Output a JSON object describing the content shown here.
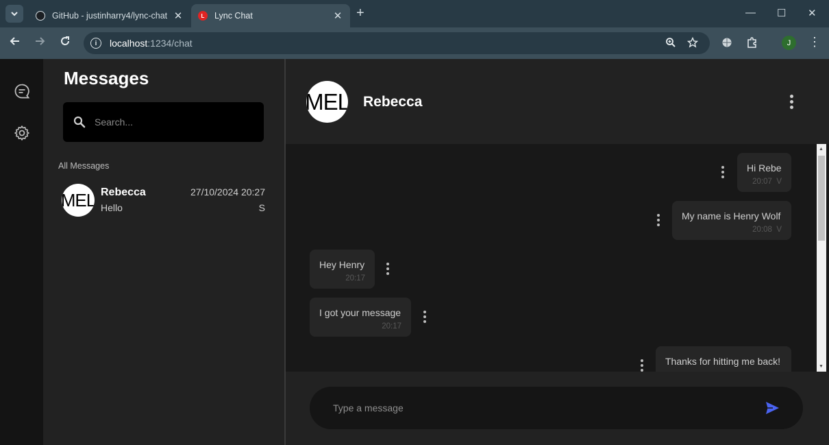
{
  "browser": {
    "tabs": [
      {
        "title": "GitHub - justinharry4/lync-chat",
        "active": false
      },
      {
        "title": "Lync Chat",
        "active": true
      }
    ],
    "url_host": "localhost",
    "url_path": ":1234/chat",
    "profile_initial": "J",
    "favicon_letter": "L"
  },
  "sidebar": {
    "title": "Messages",
    "search_placeholder": "Search...",
    "section_label": "All Messages",
    "conversations": [
      {
        "avatar_text": "MEL",
        "name": "Rebecca",
        "time": "27/10/2024 20:27",
        "last_message": "Hello",
        "status": "S"
      }
    ]
  },
  "chat": {
    "avatar_text": "MEL",
    "contact_name": "Rebecca",
    "messages": [
      {
        "text": "Hi Rebe",
        "time": "20:07",
        "status": "V",
        "direction": "outgoing"
      },
      {
        "text": "My name is Henry Wolf",
        "time": "20:08",
        "status": "V",
        "direction": "outgoing"
      },
      {
        "text": "Hey Henry",
        "time": "20:17",
        "status": "",
        "direction": "incoming"
      },
      {
        "text": "I got your message",
        "time": "20:17",
        "status": "",
        "direction": "incoming"
      },
      {
        "text": "Thanks for hitting me back!",
        "time": "",
        "status": "",
        "direction": "outgoing"
      }
    ],
    "composer_placeholder": "Type a message"
  },
  "colors": {
    "accent_send": "#4a63f0",
    "background": "#181818",
    "panel": "#222222"
  }
}
